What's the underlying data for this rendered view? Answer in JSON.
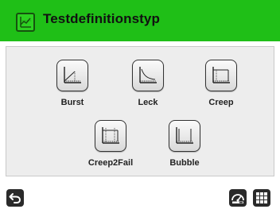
{
  "header": {
    "title": "Testdefinitionstyp",
    "icon": "chart-window-icon",
    "color": "#1fbf17"
  },
  "tiles": [
    {
      "label": "Burst",
      "icon": "burst-chart-icon"
    },
    {
      "label": "Leck",
      "icon": "leak-decay-chart-icon"
    },
    {
      "label": "Creep",
      "icon": "creep-chart-icon"
    },
    {
      "label": "Creep2Fail",
      "icon": "creep-to-fail-chart-icon"
    },
    {
      "label": "Bubble",
      "icon": "bubble-chart-icon"
    }
  ],
  "footer": {
    "back_icon": "back-arrow-icon",
    "gauge_icon": "gauge-icon",
    "menu_icon": "grid-menu-icon"
  }
}
